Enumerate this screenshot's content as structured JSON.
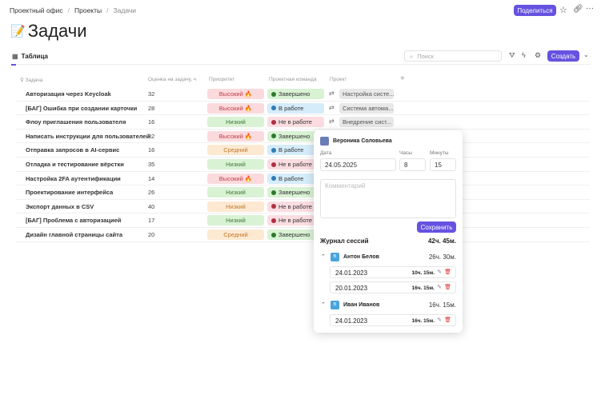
{
  "breadcrumbs": [
    "Проектный офис",
    "Проекты",
    "Задачи"
  ],
  "header": {
    "share": "Поделиться",
    "title": "Задачи",
    "title_icon": "📝"
  },
  "toolbar": {
    "view_tab": "Таблица",
    "search_placeholder": "Поиск",
    "create": "Создать"
  },
  "columns": [
    "Задача",
    "Оценка на задачу, ч",
    "Приоритет",
    "Проектная команда",
    "Проект"
  ],
  "colors": {
    "accent": "#6552e0",
    "high_bg": "#fadadd",
    "low_bg": "#d9f2d4",
    "mid_bg": "#fde9d2",
    "done": "#d9f2d4",
    "work": "#d5ecfa",
    "notwork": "#fbdde1"
  },
  "rows": [
    {
      "task": "Авторизация через Keycloak",
      "est": "32",
      "priority": "Высокий 🔥",
      "p": "high",
      "status": "Завершено",
      "s": "done",
      "project": "Настройка систе..."
    },
    {
      "task": "[БАГ] Ошибка при создании карточки",
      "est": "28",
      "priority": "Высокий 🔥",
      "p": "high",
      "status": "В работе",
      "s": "work",
      "project": "Система автома..."
    },
    {
      "task": "Флоу приглашения пользователя",
      "est": "16",
      "priority": "Низкий",
      "p": "low",
      "status": "Не в работе",
      "s": "notwork",
      "project": "Внедрение сист..."
    },
    {
      "task": "Написать инструкции для пользователей",
      "est": "32",
      "priority": "Высокий 🔥",
      "p": "high",
      "status": "Завершено",
      "s": "done"
    },
    {
      "task": "Отправка запросов в AI-сервис",
      "est": "16",
      "priority": "Средний",
      "p": "mid",
      "status": "В работе",
      "s": "work"
    },
    {
      "task": "Отладка и тестирование вёрстки",
      "est": "35",
      "priority": "Низкий",
      "p": "low",
      "status": "Не в работе",
      "s": "notwork"
    },
    {
      "task": "Настройка 2FA аутентификации",
      "est": "14",
      "priority": "Высокий 🔥",
      "p": "high",
      "status": "В работе",
      "s": "work"
    },
    {
      "task": "Проектирование интерфейса",
      "est": "26",
      "priority": "Низкий",
      "p": "low",
      "status": "Завершено",
      "s": "done"
    },
    {
      "task": "Экспорт данных в CSV",
      "est": "40",
      "priority": "Низкий",
      "p": "mid",
      "status": "Не в работе",
      "s": "notwork"
    },
    {
      "task": "[БАГ] Проблема с авторизацией",
      "est": "17",
      "priority": "Низкий",
      "p": "low",
      "status": "Не в работе",
      "s": "notwork"
    },
    {
      "task": "Дизайн главной страницы сайта",
      "est": "20",
      "priority": "Средний",
      "p": "mid",
      "status": "Завершено",
      "s": "done"
    }
  ],
  "popup": {
    "user": "Вероника Соловьева",
    "date_label": "Дата",
    "date": "24.05.2025",
    "hours_label": "Часы",
    "hours": "8",
    "minutes_label": "Минуты",
    "minutes": "15",
    "comment_placeholder": "Комментарий",
    "save": "Сохранить",
    "log_title": "Журнал сессий",
    "log_total": "42ч. 45м.",
    "groups": [
      {
        "initial": "В",
        "name": "Антон Белов",
        "total": "26ч. 30м.",
        "sessions": [
          {
            "date": "24.01.2023",
            "dur": "10ч. 15м."
          },
          {
            "date": "20.01.2023",
            "dur": "16ч. 15м."
          }
        ]
      },
      {
        "initial": "В",
        "name": "Иван Иванов",
        "total": "16ч. 15м.",
        "sessions": [
          {
            "date": "24.01.2023",
            "dur": "16ч. 15м."
          }
        ]
      }
    ]
  }
}
